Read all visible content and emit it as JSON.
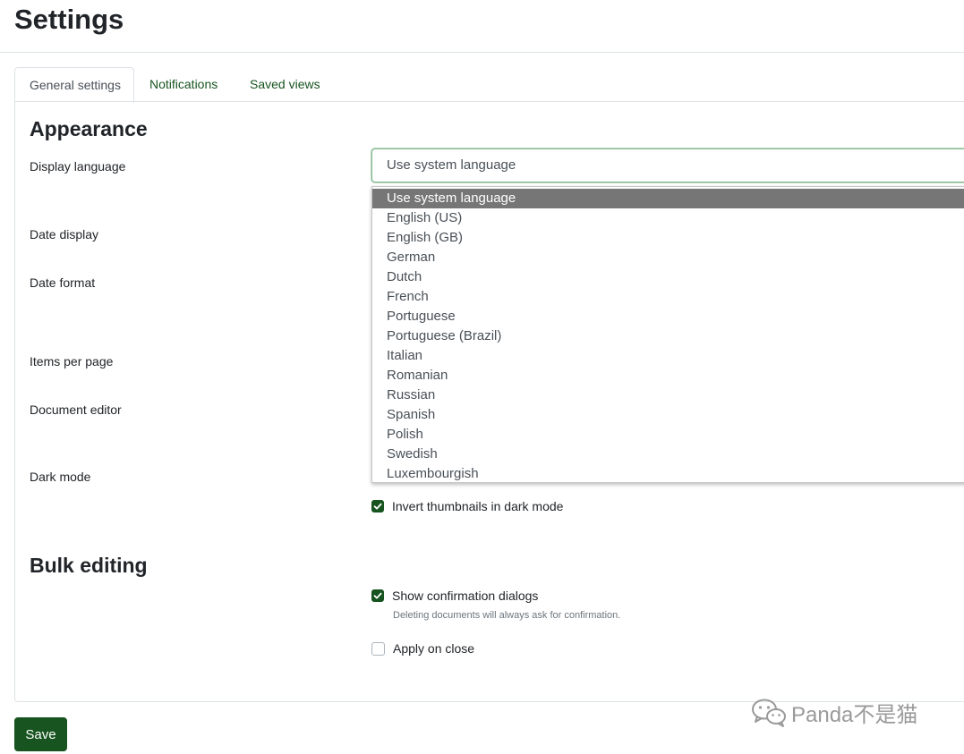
{
  "header": {
    "title": "Settings"
  },
  "tabs": [
    {
      "label": "General settings",
      "active": true
    },
    {
      "label": "Notifications",
      "active": false
    },
    {
      "label": "Saved views",
      "active": false
    }
  ],
  "appearance": {
    "title": "Appearance",
    "labels": {
      "display_language": "Display language",
      "date_display": "Date display",
      "date_format": "Date format",
      "items_per_page": "Items per page",
      "document_editor": "Document editor",
      "dark_mode": "Dark mode"
    },
    "language_select": {
      "value": "Use system language",
      "options": [
        "Use system language",
        "English (US)",
        "English (GB)",
        "German",
        "Dutch",
        "French",
        "Portuguese",
        "Portuguese (Brazil)",
        "Italian",
        "Romanian",
        "Russian",
        "Spanish",
        "Polish",
        "Swedish",
        "Luxembourgish"
      ],
      "highlighted": "Use system language"
    },
    "invert_thumbnails": {
      "label": "Invert thumbnails in dark mode",
      "checked": true
    }
  },
  "bulk_editing": {
    "title": "Bulk editing",
    "show_confirmation": {
      "label": "Show confirmation dialogs",
      "checked": true,
      "help": "Deleting documents will always ask for confirmation."
    },
    "apply_on_close": {
      "label": "Apply on close",
      "checked": false
    }
  },
  "footer": {
    "save_label": "Save"
  },
  "watermark": {
    "text": "Panda不是猫",
    "icon": "wechat-icon"
  },
  "colors": {
    "primary": "#17541f",
    "tab_link": "#17541f",
    "selected_option": "#767676",
    "border": "#dee2e6"
  }
}
